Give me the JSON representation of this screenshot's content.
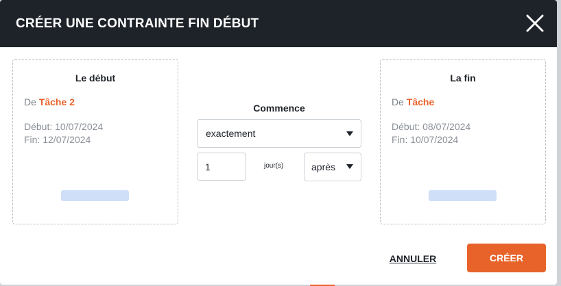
{
  "dialog": {
    "title": "CRÉER UNE CONTRAINTE FIN DÉBUT",
    "close_icon": "close-icon"
  },
  "start_card": {
    "title": "Le début",
    "task_prefix": "De",
    "task_name": "Tâche 2",
    "start_date": "Début: 10/07/2024",
    "end_date": "Fin: 12/07/2024"
  },
  "end_card": {
    "title": "La fin",
    "task_prefix": "De",
    "task_name": "Tâche",
    "start_date": "Début: 08/07/2024",
    "end_date": "Fin: 10/07/2024"
  },
  "constraint": {
    "title": "Commence",
    "mode_value": "exactement",
    "offset_value": "1",
    "unit_label": "jour(s)",
    "direction_value": "après"
  },
  "footer": {
    "cancel_label": "ANNULER",
    "create_label": "CRÉER"
  },
  "colors": {
    "header_bg": "#1e2329",
    "accent": "#e8632a",
    "placeholder": "#cfdff7"
  }
}
